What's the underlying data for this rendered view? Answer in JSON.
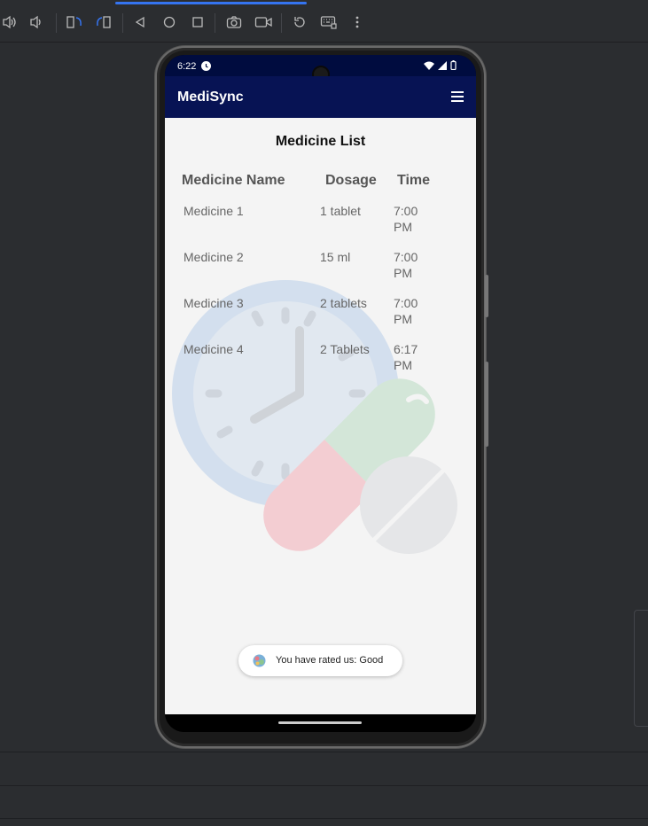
{
  "emulator": {
    "toolbar_icons": [
      "volume-up-icon",
      "volume-down-icon",
      "rotate-left-icon",
      "rotate-right-icon",
      "back-icon",
      "home-icon",
      "overview-icon",
      "screenshot-icon",
      "screen-record-icon",
      "reset-icon",
      "keyboard-icon",
      "more-icon"
    ]
  },
  "status_bar": {
    "time": "6:22",
    "icons": [
      "alarm-icon",
      "wifi-icon",
      "signal-icon",
      "battery-icon"
    ]
  },
  "app_bar": {
    "title": "MediSync",
    "menu_icon": "hamburger-menu-icon"
  },
  "page": {
    "title": "Medicine List",
    "watermark": "clock-and-pills-illustration"
  },
  "table": {
    "headers": [
      "Medicine Name",
      "Dosage",
      "Time"
    ],
    "rows": [
      {
        "name": "Medicine 1",
        "dosage": "1 tablet",
        "time": "7:00 PM"
      },
      {
        "name": "Medicine 2",
        "dosage": "15 ml",
        "time": "7:00 PM"
      },
      {
        "name": "Medicine 3",
        "dosage": "2 tablets",
        "time": "7:00 PM"
      },
      {
        "name": "Medicine 4",
        "dosage": "2 Tablets",
        "time": "6:17 PM"
      }
    ]
  },
  "toast": {
    "message": "You have rated us: Good",
    "icon": "app-logo-icon"
  },
  "colors": {
    "app_bar": "#071354",
    "status_bar": "#000c3f",
    "content_bg": "#f4f4f4",
    "accent": "#3574f0"
  }
}
